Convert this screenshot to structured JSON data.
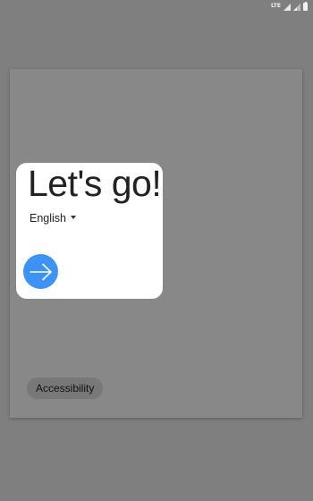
{
  "status_bar": {
    "network": "LTE",
    "icons": [
      "signal-icon",
      "signal-icon-2",
      "battery-icon"
    ]
  },
  "welcome": {
    "title": "Let's go!",
    "language": "English",
    "next_icon": "arrow-right-icon"
  },
  "footer": {
    "accessibility_label": "Accessibility"
  },
  "colors": {
    "accent": "#3d93f5",
    "background": "#7f7f7f",
    "card": "#ffffff"
  }
}
